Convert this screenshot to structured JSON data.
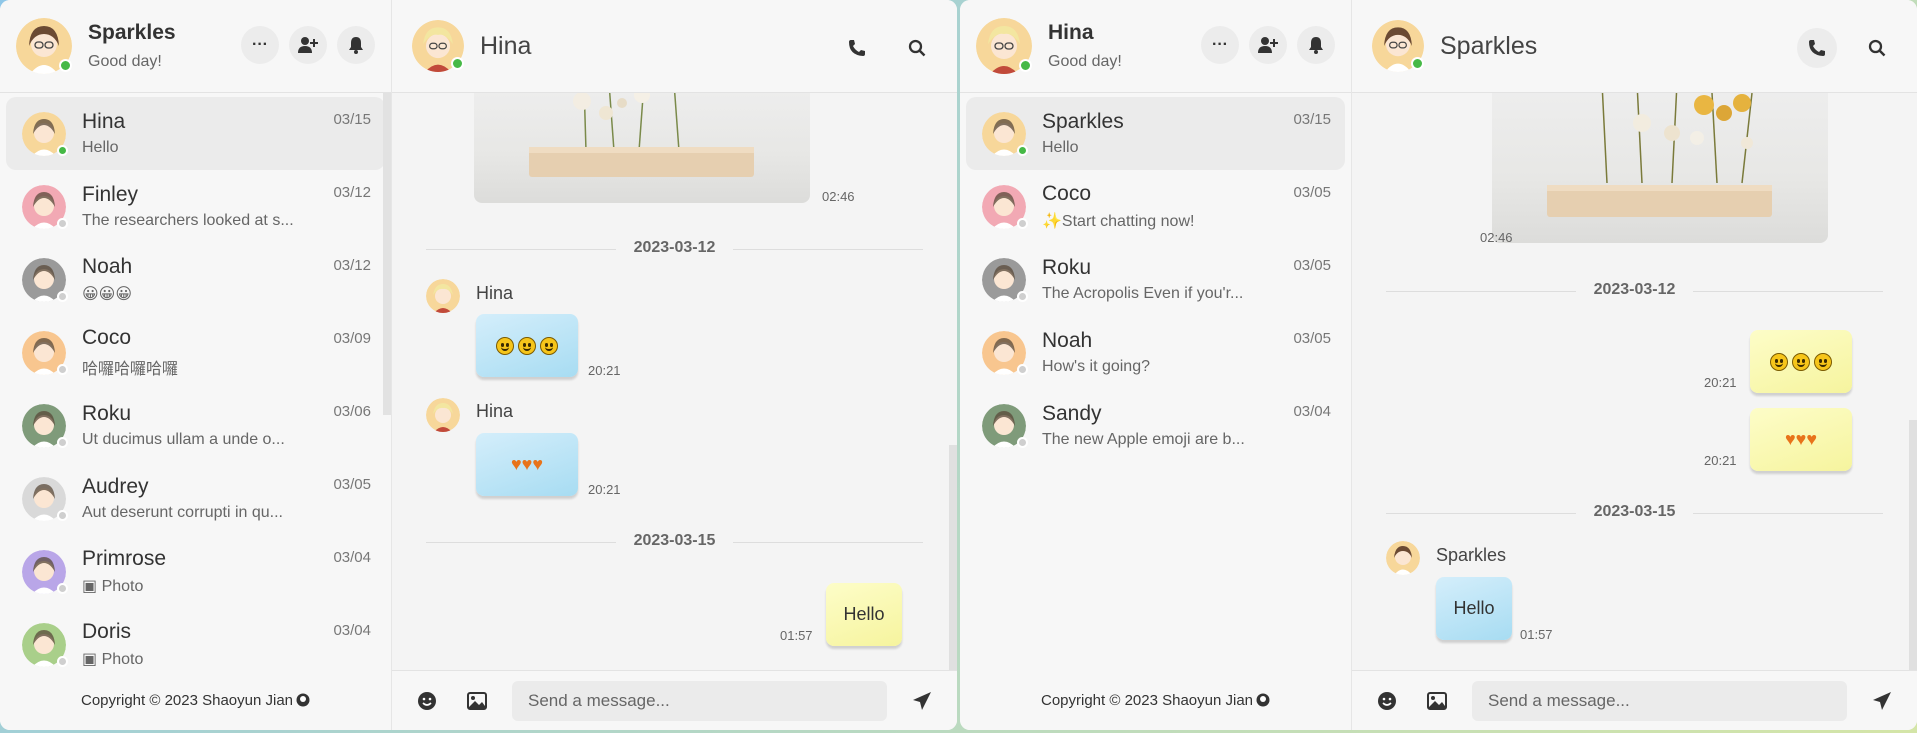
{
  "left": {
    "me": {
      "name": "Sparkles",
      "status": "Good day!"
    },
    "contacts": [
      {
        "name": "Hina",
        "date": "03/15",
        "last": "Hello",
        "online": true,
        "selected": true
      },
      {
        "name": "Finley",
        "date": "03/12",
        "last": "The researchers looked at s...",
        "online": false
      },
      {
        "name": "Noah",
        "date": "03/12",
        "last": "😀😀😀",
        "online": false
      },
      {
        "name": "Coco",
        "date": "03/09",
        "last": "哈囉哈囉哈囉",
        "online": false
      },
      {
        "name": "Roku",
        "date": "03/06",
        "last": "Ut ducimus ullam a unde o...",
        "online": false
      },
      {
        "name": "Audrey",
        "date": "03/05",
        "last": "Aut deserunt corrupti in qu...",
        "online": false
      },
      {
        "name": "Primrose",
        "date": "03/04",
        "last": "Photo",
        "online": false
      },
      {
        "name": "Doris",
        "date": "03/04",
        "last": "Photo",
        "online": false
      }
    ],
    "footer": "Copyright © 2023 Shaoyun Jian",
    "chat": {
      "title": "Hina",
      "messages": {
        "photo_time": "02:46",
        "date1": "2023-03-12",
        "m1_sender": "Hina",
        "m1_time": "20:21",
        "m2_sender": "Hina",
        "m2_time": "20:21",
        "date2": "2023-03-15",
        "m3_text": "Hello",
        "m3_time": "01:57"
      },
      "placeholder": "Send a message..."
    }
  },
  "right": {
    "me": {
      "name": "Hina",
      "status": "Good day!"
    },
    "contacts": [
      {
        "name": "Sparkles",
        "date": "03/15",
        "last": "Hello",
        "online": true,
        "selected": true
      },
      {
        "name": "Coco",
        "date": "03/05",
        "last": "✨Start chatting now!",
        "online": false
      },
      {
        "name": "Roku",
        "date": "03/05",
        "last": "The Acropolis Even if you'r...",
        "online": false
      },
      {
        "name": "Noah",
        "date": "03/05",
        "last": "How's it going?",
        "online": false
      },
      {
        "name": "Sandy",
        "date": "03/04",
        "last": "The new Apple emoji are b...",
        "online": false
      }
    ],
    "footer": "Copyright © 2023 Shaoyun Jian",
    "chat": {
      "title": "Sparkles",
      "messages": {
        "photo_time": "02:46",
        "date1": "2023-03-12",
        "m1_time": "20:21",
        "m2_time": "20:21",
        "date2": "2023-03-15",
        "m3_sender": "Sparkles",
        "m3_text": "Hello",
        "m3_time": "01:57"
      },
      "placeholder": "Send a message..."
    }
  },
  "icons": [
    "more-icon",
    "add-user-icon",
    "bell-icon",
    "phone-icon",
    "search-icon",
    "smile-icon",
    "image-icon",
    "send-icon",
    "github-icon",
    "cursor-hand-icon"
  ],
  "colors": {
    "online": "#46b946",
    "bubble_blue": "#a7dcf2",
    "bubble_yellow": "#f6f49e",
    "heart": "#e8731a"
  }
}
